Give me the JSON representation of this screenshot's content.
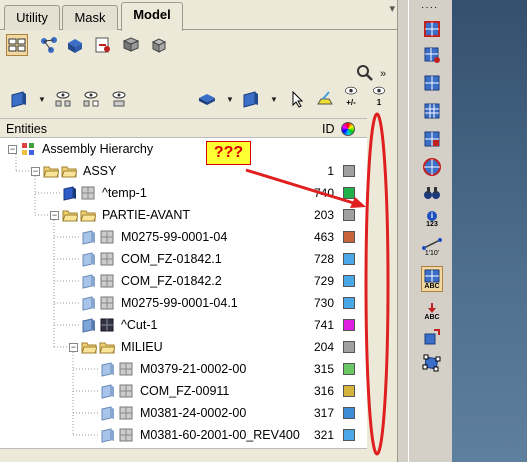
{
  "tabs": [
    "Utility",
    "Mask",
    "Model"
  ],
  "active_tab": "Model",
  "columns": {
    "entities": "Entities",
    "id": "ID"
  },
  "tree": {
    "root_label": "Assembly Hierarchy",
    "rows": [
      {
        "label": "ASSY",
        "id": "1",
        "color": "#a0a0a0",
        "depth": 1,
        "type": "folder-open"
      },
      {
        "label": "^temp-1",
        "id": "740",
        "color": "#22b24c",
        "depth": 2,
        "type": "comp-blue"
      },
      {
        "label": "PARTIE-AVANT",
        "id": "203",
        "color": "#a0a0a0",
        "depth": 2,
        "type": "folder-open"
      },
      {
        "label": "M0275-99-0001-04",
        "id": "463",
        "color": "#c8643c",
        "depth": 3,
        "type": "comp"
      },
      {
        "label": "COM_FZ-01842.1",
        "id": "728",
        "color": "#4aa8e8",
        "depth": 3,
        "type": "comp"
      },
      {
        "label": "COM_FZ-01842.2",
        "id": "729",
        "color": "#4aa8e8",
        "depth": 3,
        "type": "comp"
      },
      {
        "label": "M0275-99-0001-04.1",
        "id": "730",
        "color": "#4aa8e8",
        "depth": 3,
        "type": "comp"
      },
      {
        "label": "^Cut-1",
        "id": "741",
        "color": "#e020e0",
        "depth": 3,
        "type": "comp-dark"
      },
      {
        "label": "MILIEU",
        "id": "204",
        "color": "#a0a0a0",
        "depth": 3,
        "type": "folder-open"
      },
      {
        "label": "M0379-21-0002-00",
        "id": "315",
        "color": "#6cc864",
        "depth": 4,
        "type": "comp"
      },
      {
        "label": "COM_FZ-00911",
        "id": "316",
        "color": "#d4b43c",
        "depth": 4,
        "type": "comp"
      },
      {
        "label": "M0381-24-0002-00",
        "id": "317",
        "color": "#3c8cd8",
        "depth": 4,
        "type": "comp"
      },
      {
        "label": "M0381-60-2001-00_REV400",
        "id": "321",
        "color": "#4aa8e8",
        "depth": 4,
        "type": "comp"
      }
    ]
  },
  "annotation": {
    "text": "???"
  },
  "toolbar": {
    "row1": [
      "model-browser-icon",
      "connectivity-icon",
      "parts-icon",
      "include-icon",
      "assembly-icon",
      "part-set-icon"
    ],
    "row2": [
      "show-icon",
      "isolate-icon",
      "hide-icon"
    ],
    "row2_right": [
      "component-icon",
      "surface-icon",
      "select-arrow-icon",
      "highlight-icon"
    ],
    "eye_labels": [
      "+/-",
      "1"
    ]
  },
  "rightbar": {
    "labels": {
      "info": "123",
      "abc1": "ABC",
      "abc2": "ABC",
      "scale": "1'10'"
    }
  },
  "colors": {
    "accent": "#e02020",
    "selected_tab_bg": "#ece9d8"
  }
}
